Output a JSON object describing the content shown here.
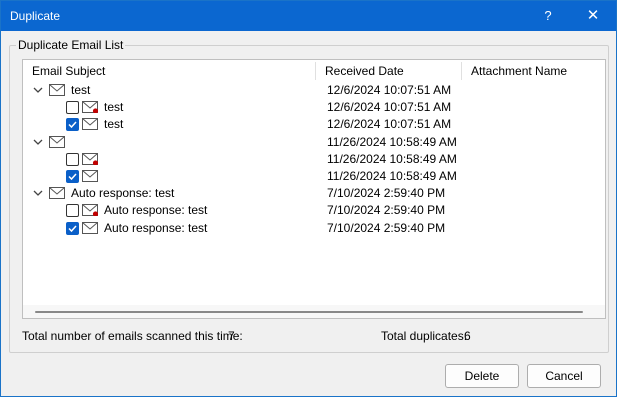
{
  "window": {
    "title": "Duplicate",
    "help_label": "?",
    "close_label": "✕"
  },
  "group": {
    "label": "Duplicate Email List"
  },
  "list": {
    "columns": [
      "Email Subject",
      "Received Date",
      "Attachment Name"
    ],
    "rows": [
      {
        "level": 0,
        "expanded": true,
        "subject": "test",
        "date": "12/6/2024 10:07:51 AM"
      },
      {
        "level": 1,
        "checked": false,
        "unread": true,
        "subject": "test",
        "date": "12/6/2024 10:07:51 AM"
      },
      {
        "level": 1,
        "checked": true,
        "unread": false,
        "subject": "test",
        "date": "12/6/2024 10:07:51 AM"
      },
      {
        "level": 0,
        "expanded": true,
        "subject": "",
        "date": "11/26/2024 10:58:49 AM"
      },
      {
        "level": 1,
        "checked": false,
        "unread": true,
        "subject": "",
        "date": "11/26/2024 10:58:49 AM"
      },
      {
        "level": 1,
        "checked": true,
        "unread": false,
        "subject": "",
        "date": "11/26/2024 10:58:49 AM"
      },
      {
        "level": 0,
        "expanded": true,
        "subject": "Auto response: test",
        "date": "7/10/2024 2:59:40 PM"
      },
      {
        "level": 1,
        "checked": false,
        "unread": true,
        "subject": "Auto response: test",
        "date": "7/10/2024 2:59:40 PM"
      },
      {
        "level": 1,
        "checked": true,
        "unread": false,
        "subject": "Auto response: test",
        "date": "7/10/2024 2:59:40 PM"
      }
    ]
  },
  "status": {
    "scanned_label": "Total number of emails scanned this time:",
    "scanned_value": "7",
    "dups_label": "Total duplicates:",
    "dups_value": "6"
  },
  "buttons": {
    "delete": "Delete",
    "cancel": "Cancel"
  },
  "colors": {
    "titlebar": "#0b67d0",
    "checkbox": "#0a5fc8",
    "unread_dot": "#c00000"
  }
}
